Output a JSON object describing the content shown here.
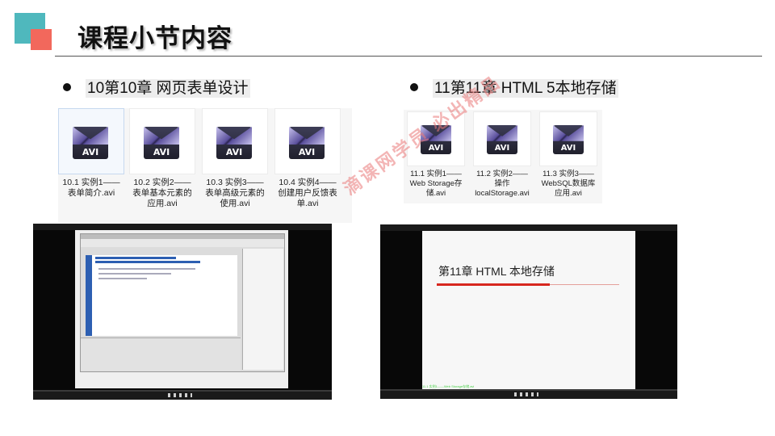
{
  "header": {
    "title": "课程小节内容"
  },
  "sections": [
    {
      "heading": "10第10章 网页表单设计",
      "files": [
        {
          "name": "10.1 实例1——表单简介.avi",
          "lines": [
            "10.1 实例1——",
            "表单简介.avi"
          ],
          "icon": "avi-video-icon",
          "selected": true
        },
        {
          "name": "10.2 实例2——表单基本元素的应用.avi",
          "lines": [
            "10.2 实例2——",
            "表单基本元素的",
            "应用.avi"
          ],
          "icon": "avi-video-icon"
        },
        {
          "name": "10.3 实例3——表单高级元素的使用.avi",
          "lines": [
            "10.3 实例3——",
            "表单高级元素的",
            "使用.avi"
          ],
          "icon": "avi-video-icon"
        },
        {
          "name": "10.4 实例4——创建用户反馈表单.avi",
          "lines": [
            "10.4 实例4——",
            "创建用户反馈表",
            "单.avi"
          ],
          "icon": "avi-video-icon"
        }
      ]
    },
    {
      "heading": "11第11章 HTML 5本地存储",
      "files": [
        {
          "name": "11.1 实例1——Web Storage存储.avi",
          "lines": [
            "11.1 实例1——",
            "Web Storage存",
            "储.avi"
          ],
          "icon": "avi-video-icon"
        },
        {
          "name": "11.2 实例2——操作localStorage.avi",
          "lines": [
            "11.2 实例2——",
            "操作",
            "localStorage.avi"
          ],
          "icon": "avi-video-icon"
        },
        {
          "name": "11.3 实例3——WebSQL数据库应用.avi",
          "lines": [
            "11.3 实例3——",
            "WebSQL数据库",
            "应用.avi"
          ],
          "icon": "avi-video-icon"
        }
      ]
    }
  ],
  "icon_label": "AVI",
  "video_right": {
    "slide_title": "第11章 HTML 本地存储",
    "caption": "11.1 实例1——Web Storage存储.avi"
  },
  "watermark": "滴课网学员 必出精品",
  "colors": {
    "teal": "#4fb8bd",
    "coral": "#f2685c",
    "accent_red": "#d7271f"
  }
}
